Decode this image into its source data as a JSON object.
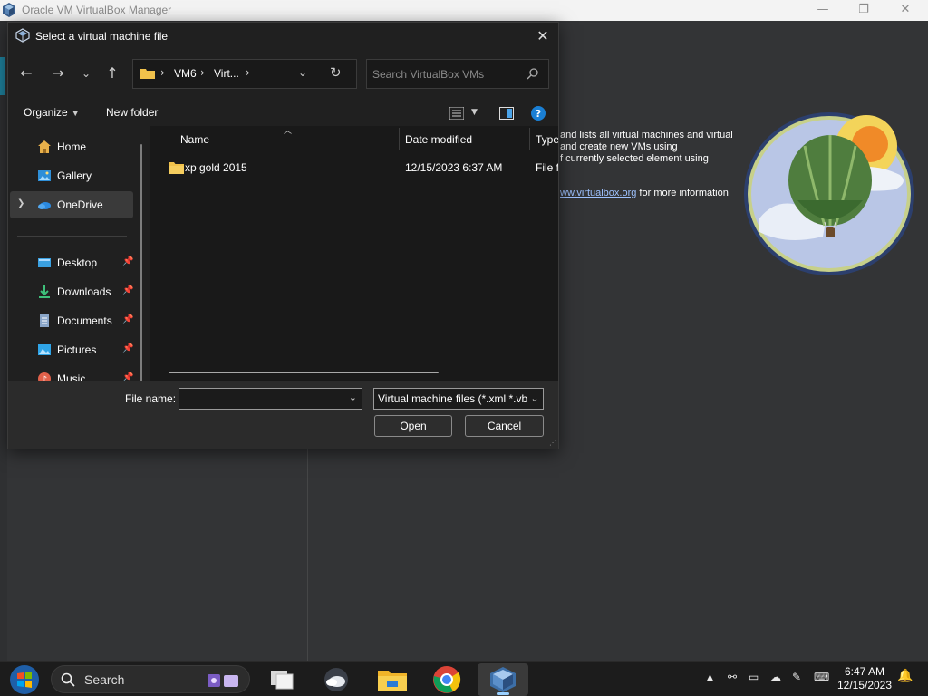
{
  "vbox": {
    "title": "Oracle VM VirtualBox Manager",
    "welcome": {
      "line1": "and lists all virtual machines and virtual",
      "line2": "and create new VMs using",
      "line3": "f currently selected element using",
      "link": "ww.virtualbox.org",
      "line4": " for more information"
    }
  },
  "dialog": {
    "title": "Select a virtual machine file",
    "address": {
      "crumb1": "VM6",
      "crumb2": "Virt...",
      "sep": "›"
    },
    "search": {
      "placeholder": "Search VirtualBox VMs"
    },
    "toolbar": {
      "organize": "Organize",
      "new_folder": "New folder"
    },
    "nav": {
      "home": "Home",
      "gallery": "Gallery",
      "onedrive": "OneDrive",
      "desktop": "Desktop",
      "downloads": "Downloads",
      "documents": "Documents",
      "pictures": "Pictures",
      "music": "Music"
    },
    "columns": {
      "name": "Name",
      "date": "Date modified",
      "type": "Type"
    },
    "files": [
      {
        "name": "xp gold 2015",
        "date": "12/15/2023 6:37 AM",
        "type": "File fo"
      }
    ],
    "footer": {
      "file_name_label": "File name:",
      "file_name_value": "",
      "file_type": "Virtual machine files (*.xml *.vbox)",
      "open": "Open",
      "cancel": "Cancel"
    }
  },
  "taskbar": {
    "search_label": "Search",
    "time": "6:47 AM",
    "date": "12/15/2023"
  },
  "colors": {
    "dialog_bg": "#202020",
    "list_bg": "#191919",
    "accent": "#1e7f9a",
    "link": "#9ec2ff"
  }
}
